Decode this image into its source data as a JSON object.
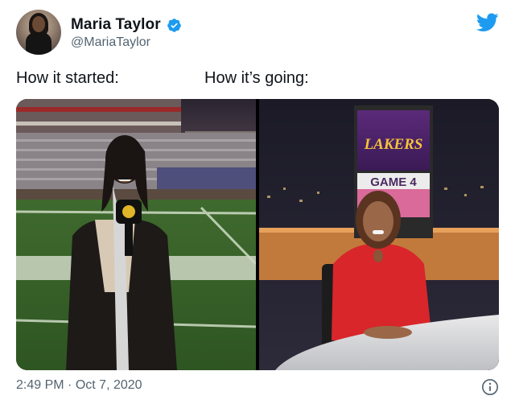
{
  "author": {
    "display_name": "Maria Taylor",
    "handle": "@MariaTaylor",
    "verified": true
  },
  "tweet": {
    "caption_left": "How it started:",
    "caption_right": "How it’s going:",
    "time": "2:49 PM",
    "separator": "·",
    "date": "Oct 7, 2020"
  },
  "media": {
    "right_photo_text": {
      "logo": "LAKERS",
      "banner": "GAME 4"
    }
  },
  "colors": {
    "twitter_blue": "#1d9bf0",
    "text_secondary": "#536471"
  },
  "icons": [
    "twitter-bird-icon",
    "verified-badge-icon",
    "info-icon"
  ]
}
